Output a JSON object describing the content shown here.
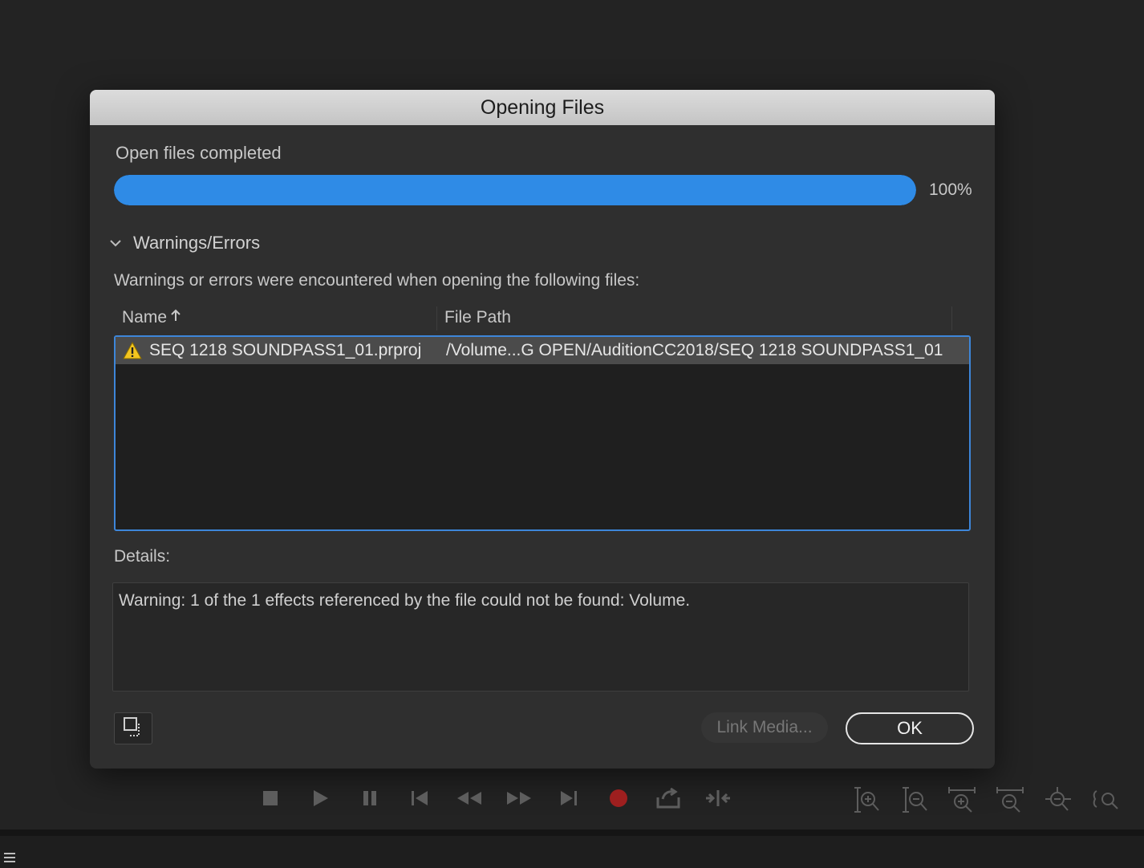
{
  "dialog": {
    "title": "Opening Files",
    "status_label": "Open files completed",
    "progress": {
      "percent_text": "100%",
      "value_fraction": 1.0,
      "color": "#2f8be6"
    },
    "warnings": {
      "toggle_icon": "chevron-down-icon",
      "title": "Warnings/Errors",
      "description": "Warnings or errors were encountered when opening the following files:",
      "columns": [
        {
          "label": "Name",
          "sort_icon": "sort-ascending-icon"
        },
        {
          "label": "File Path"
        }
      ],
      "rows": [
        {
          "icon": "warning-icon",
          "name": "SEQ 1218 SOUNDPASS1_01.prproj",
          "path": "/Volume...G OPEN/AuditionCC2018/SEQ 1218 SOUNDPASS1_01"
        }
      ]
    },
    "details": {
      "label": "Details:",
      "text": "Warning: 1 of the 1 effects referenced by the file could not be found: Volume."
    },
    "buttons": {
      "copy_icon": "copy-icon",
      "link_media": "Link Media...",
      "ok": "OK"
    }
  },
  "transport": {
    "icons": [
      "stop-icon",
      "play-icon",
      "pause-icon",
      "skip-to-start-icon",
      "rewind-icon",
      "fast-forward-icon",
      "skip-to-end-icon",
      "record-icon",
      "loop-icon",
      "skip-icon"
    ],
    "record_color": "#9e1f1f"
  },
  "zoom_tools": {
    "icons": [
      "zoom-in-amplitude-icon",
      "zoom-out-amplitude-icon",
      "zoom-in-time-icon",
      "zoom-out-time-icon",
      "zoom-full-icon",
      "zoom-selection-icon"
    ]
  },
  "bottom_bar": {
    "menu_icon": "menu-icon"
  }
}
